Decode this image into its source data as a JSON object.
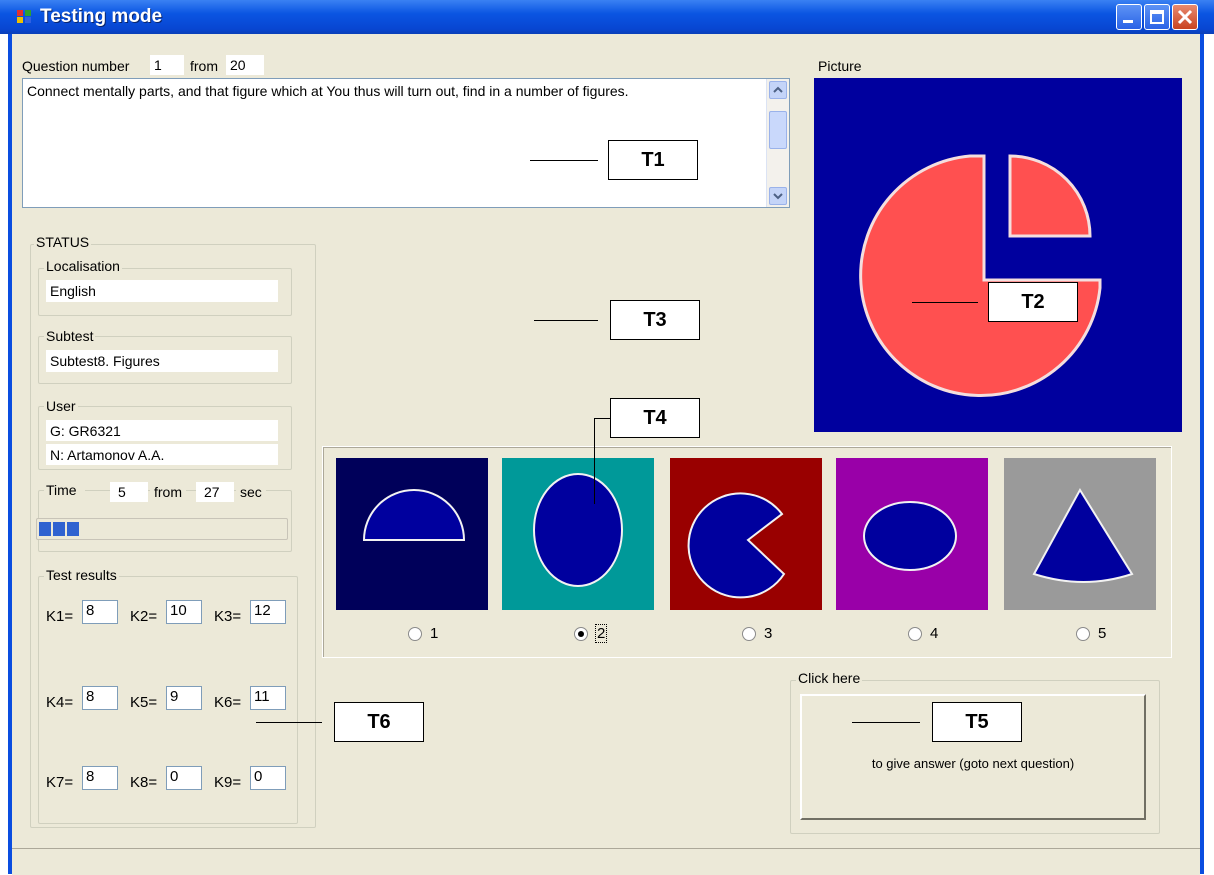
{
  "window": {
    "title": "Testing mode"
  },
  "question": {
    "label": "Question number",
    "number": "1",
    "from_label": "from",
    "total": "20",
    "text": "Connect mentally parts, and that figure which at You thus will turn out, find in a number of figures."
  },
  "picture": {
    "label": "Picture"
  },
  "status": {
    "title": "STATUS",
    "localisation": {
      "label": "Localisation",
      "value": "English"
    },
    "subtest": {
      "label": "Subtest",
      "value": "Subtest8. Figures"
    },
    "user": {
      "label": "User",
      "group": "G: GR6321",
      "name": "N: Artamonov A.A."
    },
    "time": {
      "label": "Time",
      "value": "5",
      "from_label": "from",
      "total": "27",
      "unit": "sec",
      "progress": 0.19
    }
  },
  "results": {
    "title": "Test results",
    "items": [
      {
        "label": "K1=",
        "value": "8"
      },
      {
        "label": "K4=",
        "value": "8"
      },
      {
        "label": "K7=",
        "value": "8"
      },
      {
        "label": "K2=",
        "value": "10"
      },
      {
        "label": "K5=",
        "value": "9"
      },
      {
        "label": "K8=",
        "value": "0"
      },
      {
        "label": "K3=",
        "value": "12"
      },
      {
        "label": "K6=",
        "value": "11"
      },
      {
        "label": "K9=",
        "value": "0"
      }
    ]
  },
  "options": [
    {
      "label": "1",
      "bg": "#00005a",
      "shape": "half-disk",
      "selected": false
    },
    {
      "label": "2",
      "bg": "#009999",
      "shape": "ellipse-vertical",
      "selected": true
    },
    {
      "label": "3",
      "bg": "#990000",
      "shape": "pacman",
      "selected": false
    },
    {
      "label": "4",
      "bg": "#9900a8",
      "shape": "ellipse-horizontal",
      "selected": false
    },
    {
      "label": "5",
      "bg": "#9a9a9a",
      "shape": "cone",
      "selected": false
    }
  ],
  "answer": {
    "group_label": "Click here",
    "button_text": "to give answer (goto next question)"
  },
  "annotations": {
    "t1": "T1",
    "t2": "T2",
    "t3": "T3",
    "t4": "T4",
    "t5": "T5",
    "t6": "T6"
  },
  "colors": {
    "figure_fill": "#ff5050",
    "figure_bg": "#00009e",
    "option_shape": "#00009e",
    "title_bar": "#0a55e2"
  }
}
